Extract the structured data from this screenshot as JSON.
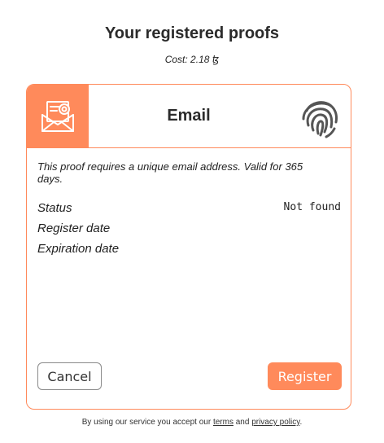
{
  "page": {
    "title": "Your registered proofs",
    "cost_prefix": "Cost: 2.18 ",
    "cost_unit": "ꜩ"
  },
  "card": {
    "icon": "email-envelope-icon",
    "title": "Email",
    "badge_icon": "fingerprint-icon",
    "description": "This proof requires a unique email address. Valid for 365 days.",
    "fields": [
      {
        "label": "Status",
        "value": "Not found"
      },
      {
        "label": "Register date",
        "value": ""
      },
      {
        "label": "Expiration date",
        "value": ""
      }
    ],
    "cancel_label": "Cancel",
    "register_label": "Register"
  },
  "footer": {
    "prefix": "By using our service you accept our ",
    "terms_label": "terms",
    "and": " and ",
    "privacy_label": "privacy policy",
    "suffix": "."
  },
  "colors": {
    "accent": "#ff8a5b",
    "text": "#2b2b2b"
  }
}
